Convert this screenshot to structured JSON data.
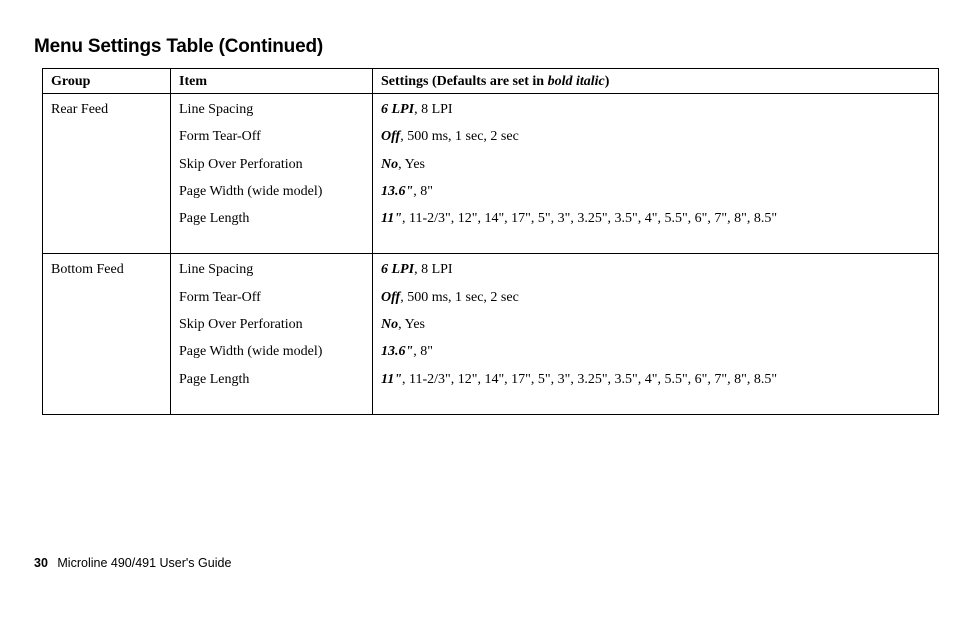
{
  "title": "Menu Settings Table (Continued)",
  "headers": {
    "group": "Group",
    "item": "Item",
    "settings_prefix": "Settings (Defaults are set in ",
    "settings_emph": "bold italic",
    "settings_suffix": ")"
  },
  "groups": [
    {
      "name": "Rear Feed",
      "rows": [
        {
          "item": "Line Spacing",
          "default": "6 LPI",
          "rest": ", 8 LPI"
        },
        {
          "item": "Form Tear-Off",
          "default": "Off",
          "rest": ", 500 ms, 1 sec, 2 sec"
        },
        {
          "item": "Skip Over Perforation",
          "default": "No",
          "rest": ", Yes"
        },
        {
          "item": "Page Width (wide model)",
          "default": "13.6\"",
          "rest": ", 8\""
        },
        {
          "item": "Page Length",
          "default": "11\"",
          "rest": ", 11-2/3\", 12\", 14\", 17\", 5\", 3\", 3.25\", 3.5\", 4\", 5.5\", 6\", 7\", 8\", 8.5\""
        }
      ]
    },
    {
      "name": "Bottom Feed",
      "rows": [
        {
          "item": "Line Spacing",
          "default": "6 LPI",
          "rest": ", 8 LPI"
        },
        {
          "item": "Form Tear-Off",
          "default": "Off",
          "rest": ", 500 ms, 1 sec, 2 sec"
        },
        {
          "item": "Skip Over Perforation",
          "default": "No",
          "rest": ", Yes"
        },
        {
          "item": "Page Width (wide model)",
          "default": "13.6\"",
          "rest": ", 8\""
        },
        {
          "item": "Page Length",
          "default": "11\"",
          "rest": ", 11-2/3\", 12\", 14\", 17\", 5\", 3\", 3.25\", 3.5\", 4\", 5.5\", 6\", 7\", 8\", 8.5\""
        }
      ]
    }
  ],
  "footer": {
    "page_number": "30",
    "book_title": "Microline 490/491 User's Guide"
  }
}
